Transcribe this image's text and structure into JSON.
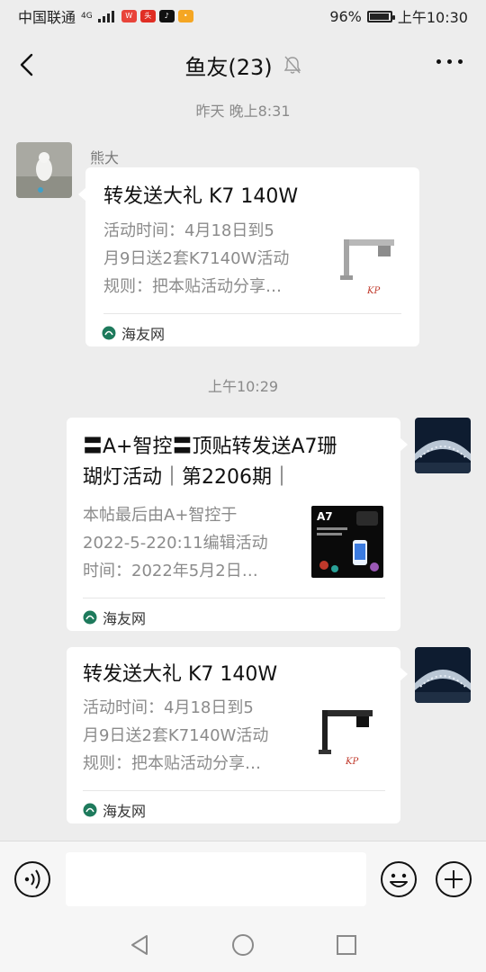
{
  "status_bar": {
    "carrier": "中国联通",
    "network": "4G",
    "battery_percent": "96%",
    "battery_level": 0.96,
    "time": "上午10:30",
    "app_badges": [
      "weibo-badge",
      "toutiao-badge",
      "tiktok-badge",
      "app-badge"
    ]
  },
  "header": {
    "title": "鱼友(23)",
    "icons": [
      "back-icon",
      "mute-icon",
      "more-icon"
    ]
  },
  "messages": [
    {
      "timestamp": "昨天 晚上8:31",
      "sender": "熊大",
      "side": "left",
      "card": {
        "title": "转发送大礼 K7 140W",
        "desc": "活动时间：4月18日到5月9日送2套K7140W活动规则：把本贴活动分享…",
        "desc_lines": [
          "活动时间：4月18日到5",
          "月9日送2套K7140W活动",
          "规则：把本贴活动分享…"
        ],
        "source": "海友网",
        "thumb_logo": "KP"
      }
    },
    {
      "timestamp": "上午10:29",
      "side": "right",
      "card": {
        "title_lines": [
          "〓A+智控〓顶贴转发送A7珊",
          "瑚灯活动｜第2206期｜"
        ],
        "desc_lines": [
          "本帖最后由A+智控于",
          "2022-5-220:11编辑活动",
          "时间：2022年5月2日…"
        ],
        "source": "海友网",
        "thumb_label": "A7"
      }
    },
    {
      "side": "right",
      "card": {
        "title": "转发送大礼 K7 140W",
        "desc_lines": [
          "活动时间：4月18日到5",
          "月9日送2套K7140W活动",
          "规则：把本贴活动分享…"
        ],
        "source": "海友网",
        "thumb_logo": "KP"
      }
    }
  ],
  "input_bar": {
    "value": "",
    "icons": [
      "voice-icon",
      "emoji-icon",
      "plus-icon"
    ]
  },
  "nav_bar": {
    "icons": [
      "nav-back-icon",
      "nav-home-icon",
      "nav-recent-icon"
    ]
  },
  "colors": {
    "background": "#ededed",
    "card": "#ffffff",
    "muted_text": "#8b8b8b",
    "source_icon": "#1e7a5c"
  }
}
